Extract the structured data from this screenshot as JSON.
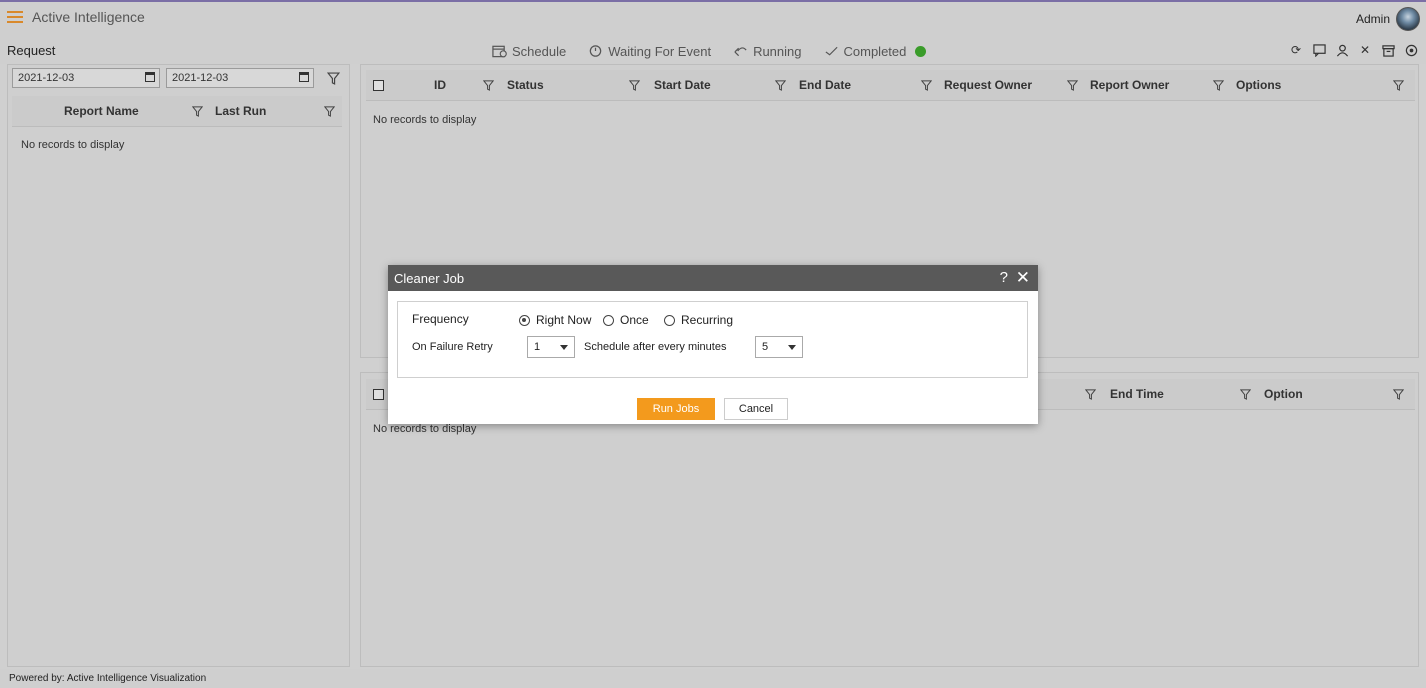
{
  "header": {
    "app_title": "Active Intelligence",
    "user": "Admin"
  },
  "subheader": {
    "title": "Request",
    "tabs": [
      {
        "label": "Schedule",
        "icon": "calendar-icon"
      },
      {
        "label": "Waiting For Event",
        "icon": "clock-icon"
      },
      {
        "label": "Running",
        "icon": "running-icon"
      },
      {
        "label": "Completed",
        "icon": "check-icon",
        "status_color": "#3a9c2a"
      }
    ],
    "toolbar_icons": [
      "refresh-icon",
      "comment-icon",
      "user-icon",
      "close-icon",
      "archive-icon",
      "stop-icon"
    ]
  },
  "left_panel": {
    "from_date": "2021-12-03",
    "to_date": "2021-12-03",
    "columns": [
      "Report Name",
      "Last Run"
    ],
    "empty_text": "No records to display"
  },
  "top_grid": {
    "columns": [
      "ID",
      "Status",
      "Start Date",
      "End Date",
      "Request Owner",
      "Report Owner",
      "Options"
    ],
    "empty_text": "No records to display"
  },
  "bottom_grid": {
    "columns": [
      "End Time",
      "Option"
    ],
    "empty_text": "No records to display"
  },
  "dialog": {
    "title": "Cleaner Job",
    "help": "?",
    "close": "✕",
    "frequency_label": "Frequency",
    "frequency_options": [
      {
        "label": "Right Now",
        "selected": true
      },
      {
        "label": "Once",
        "selected": false
      },
      {
        "label": "Recurring",
        "selected": false
      }
    ],
    "retry_label": "On Failure Retry",
    "retry_value": "1",
    "schedule_label": "Schedule after every minutes",
    "schedule_value": "5",
    "run_button": "Run Jobs",
    "cancel_button": "Cancel",
    "accent_color": "#f39a1d"
  },
  "footer": {
    "text": "Powered by: Active Intelligence Visualization"
  }
}
